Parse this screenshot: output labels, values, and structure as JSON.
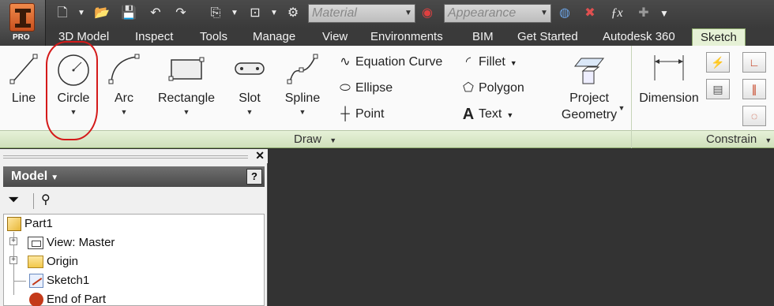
{
  "app": {
    "edition": "PRO"
  },
  "quick_access": {
    "material_placeholder": "Material",
    "appearance_placeholder": "Appearance",
    "icons": [
      "new-icon",
      "open-icon",
      "save-icon",
      "undo-icon",
      "redo-icon",
      "return-icon",
      "select-icon",
      "update-icon",
      "material-color-icon",
      "clear-override-icon",
      "fx-icon",
      "add-icon",
      "customize-icon"
    ]
  },
  "tabs": [
    {
      "label": "3D Model"
    },
    {
      "label": "Inspect"
    },
    {
      "label": "Tools"
    },
    {
      "label": "Manage"
    },
    {
      "label": "View"
    },
    {
      "label": "Environments"
    },
    {
      "label": "BIM"
    },
    {
      "label": "Get Started"
    },
    {
      "label": "Autodesk 360"
    },
    {
      "label": "Sketch",
      "active": true
    }
  ],
  "ribbon": {
    "draw": {
      "title": "Draw",
      "large": [
        {
          "label": "Line"
        },
        {
          "label": "Circle"
        },
        {
          "label": "Arc"
        },
        {
          "label": "Rectangle"
        },
        {
          "label": "Slot"
        },
        {
          "label": "Spline"
        }
      ],
      "small": [
        {
          "label": "Equation Curve"
        },
        {
          "label": "Ellipse"
        },
        {
          "label": "Point"
        },
        {
          "label": "Fillet"
        },
        {
          "label": "Polygon"
        },
        {
          "label": "Text"
        }
      ],
      "project_geometry": {
        "line1": "Project",
        "line2": "Geometry"
      }
    },
    "constrain": {
      "title": "Constrain",
      "dimension_label": "Dimension"
    }
  },
  "browser": {
    "title": "Model",
    "help": "?",
    "tree": [
      {
        "label": "Part1"
      },
      {
        "label": "View: Master"
      },
      {
        "label": "Origin"
      },
      {
        "label": "Sketch1"
      },
      {
        "label": "End of Part"
      }
    ]
  },
  "colors": {
    "active_tab": "#e6f1d6",
    "panel_bar": "#d8e8c4",
    "annotation": "#d41a1a",
    "graphics_bg": "#333333"
  }
}
